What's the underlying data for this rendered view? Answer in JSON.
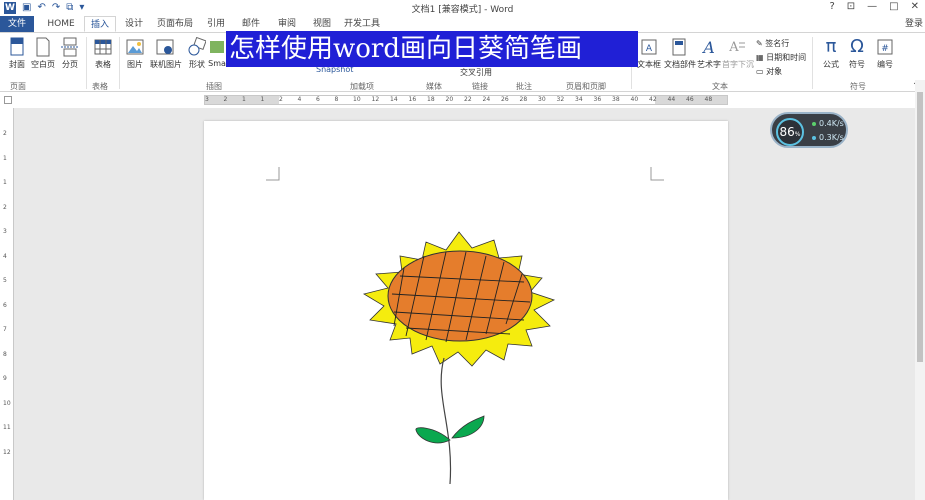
{
  "window": {
    "title": "文档1 [兼容模式] - Word",
    "controls": [
      "?",
      "□",
      "—",
      "□",
      "✕"
    ],
    "login": "登录"
  },
  "quick_access": {
    "app_icon": "word-icon",
    "save": "save-icon",
    "undo": "undo-icon",
    "redo": "redo-icon"
  },
  "tabs": [
    "文件",
    "HOME",
    "插入",
    "设计",
    "页面布局",
    "引用",
    "邮件",
    "审阅",
    "视图",
    "开发工具"
  ],
  "active_tab": "插入",
  "ribbon": {
    "buttons": [
      "封面",
      "空白页",
      "分页",
      "表格",
      "图片",
      "联机图片",
      "形状",
      "Sma",
      "文本框",
      "文档部件",
      "艺术字",
      "首字下沉",
      "公式",
      "符号",
      "编号"
    ],
    "groups": [
      "页面",
      "表格",
      "插图",
      "加载项",
      "媒体",
      "链接",
      "批注",
      "页眉和页脚",
      "文本",
      "符号"
    ],
    "text_group_items": [
      "签名行",
      "日期和时间",
      "对象"
    ],
    "links_items": [
      "交叉引用"
    ],
    "addin_item": "Snapshot"
  },
  "overlay_banner": "怎样使用word画向日葵简笔画",
  "ruler": {
    "h_ticks": [
      "3",
      "2",
      "1",
      "1",
      "2",
      "4",
      "6",
      "8",
      "10",
      "12",
      "14",
      "16",
      "18",
      "20",
      "22",
      "24",
      "26",
      "28",
      "30",
      "32",
      "34",
      "36",
      "38",
      "40",
      "42",
      "44",
      "46",
      "48"
    ],
    "v_ticks": [
      "2",
      "1",
      "1",
      "2",
      "3",
      "4",
      "5",
      "6",
      "7",
      "8",
      "9",
      "10",
      "11",
      "12"
    ]
  },
  "speed_widget": {
    "percent": "86",
    "percent_unit": "%",
    "upload": "0.4K/s",
    "download": "0.3K/s"
  },
  "colors": {
    "word_blue": "#2b579a",
    "banner_blue": "#2020d6",
    "petal_yellow": "#f5ec0e",
    "flower_center": "#e57d2c",
    "leaf_green": "#0aa84f"
  }
}
